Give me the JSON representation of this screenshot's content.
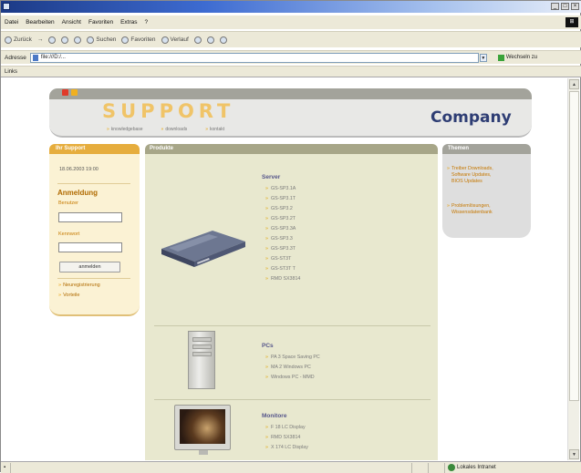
{
  "window": {
    "controls": [
      "_",
      "□",
      "×"
    ]
  },
  "menubar": {
    "items": [
      "Datei",
      "Bearbeiten",
      "Ansicht",
      "Favoriten",
      "Extras",
      "?"
    ]
  },
  "toolbar": {
    "back": "Zurück",
    "search": "Suchen",
    "favorites": "Favoriten",
    "history": "Verlauf"
  },
  "addressbar": {
    "label": "Adresse",
    "value": "file:///D:/...",
    "go": "Wechseln zu"
  },
  "linksbar": {
    "label": "Links"
  },
  "header": {
    "support_logo": "SUPPORT",
    "company_logo": "Company",
    "nav": [
      "knowledgebase",
      "downloads",
      "kontakt"
    ]
  },
  "left_box": {
    "title": "Ihr Support",
    "datetime": "18.06.2003 19:00",
    "login_heading": "Anmeldung",
    "username_label": "Benutzer",
    "password_label": "Kennwort",
    "login_button": "anmelden",
    "links": [
      "Neuregistrierung",
      "Vorteile"
    ]
  },
  "center_box": {
    "title": "Produkte",
    "categories": [
      {
        "name": "Server",
        "items": [
          "GS-SP3.1A",
          "GS-SP3.1T",
          "GS-SP3.2",
          "GS-SP3.2T",
          "GS-SP3.3A",
          "GS-SP3.3",
          "GS-SP3.3T",
          "GS-ST3T",
          "GS-ST3T T",
          "RMD SX3814"
        ]
      },
      {
        "name": "PCs",
        "items": [
          "PA 3 Space Saving PC",
          "MA 2 Windows PC",
          "Windows PC - MMD"
        ]
      },
      {
        "name": "Monitore",
        "items": [
          "F 18 LC Display",
          "RMD SX3814",
          "X 174 LC Display"
        ]
      }
    ]
  },
  "right_box": {
    "title": "Themen",
    "links": [
      [
        "Treiber Downloads,",
        "Software Updates,",
        "BIOS Updates"
      ],
      [
        "Problemlösungen,",
        "Wissensdatenbank"
      ]
    ]
  },
  "statusbar": {
    "zone": "Lokales Intranet"
  }
}
